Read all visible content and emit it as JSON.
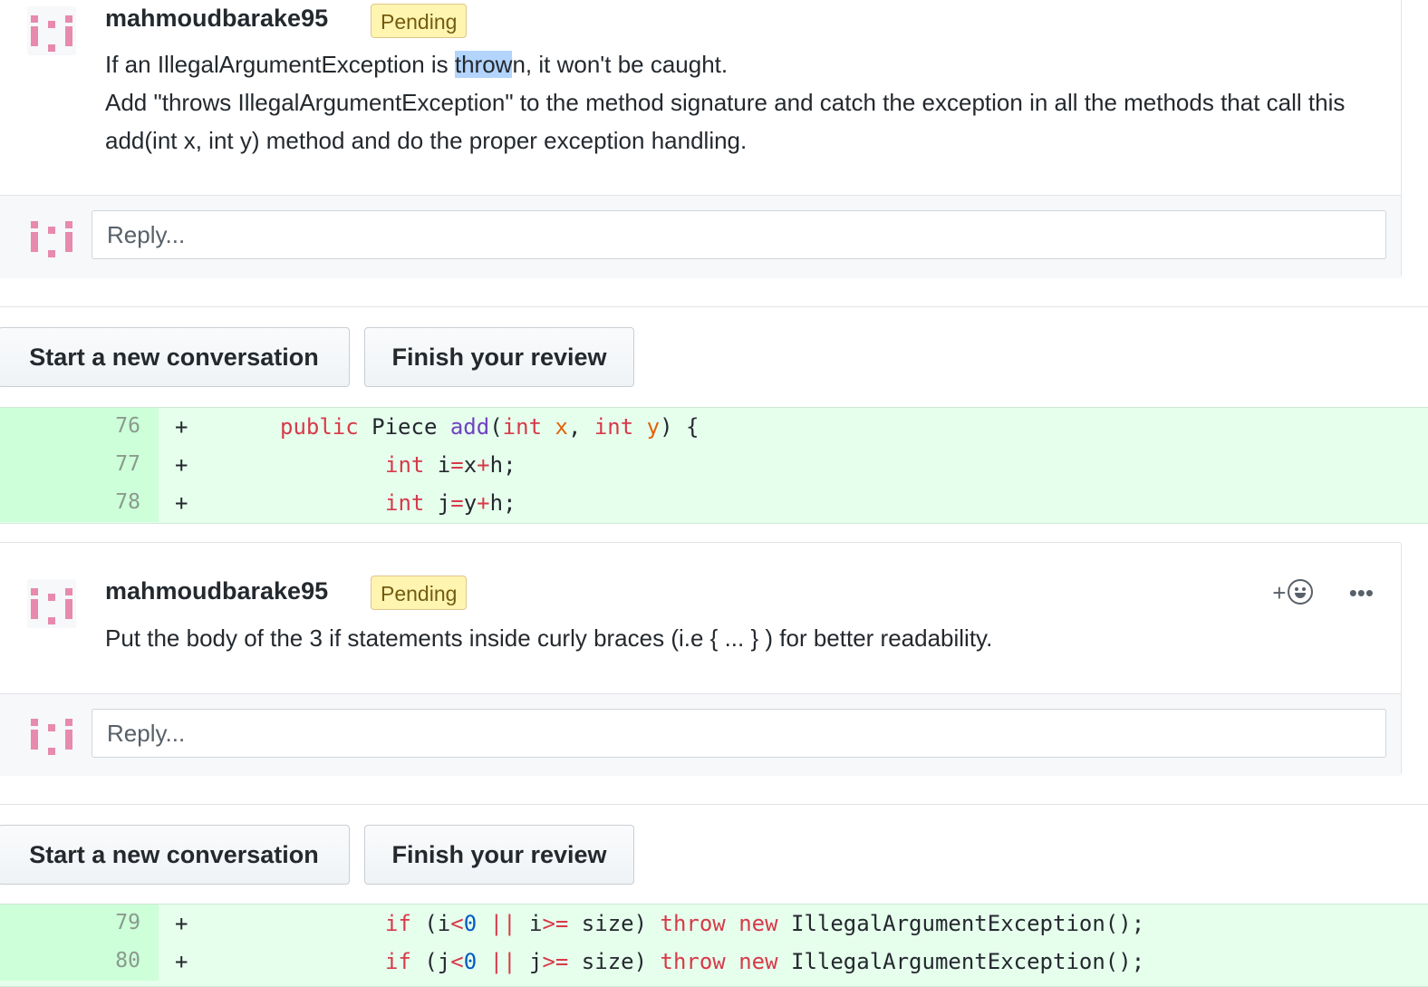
{
  "comments": [
    {
      "author": "mahmoudbarake95",
      "badge": "Pending",
      "line1_pre": "If an IllegalArgumentException is ",
      "line1_sel": "throw",
      "line1_post": "n, it won't be caught.",
      "line2": "Add \"throws IllegalArgumentException\" to the method signature and catch the exception in all the methods that call this add(int x, int y) method and do the proper exception handling.",
      "reply_placeholder": "Reply..."
    },
    {
      "author": "mahmoudbarake95",
      "badge": "Pending",
      "text": "Put the body of the 3 if statements inside curly braces (i.e { ... } ) for better readability.",
      "reply_placeholder": "Reply...",
      "reaction_icon": "smiley-plus-icon",
      "more_icon": "kebab-horizontal-icon"
    }
  ],
  "buttons": {
    "new_conversation": "Start a new conversation",
    "finish_review": "Finish your review"
  },
  "diff_blocks": [
    {
      "lines": [
        {
          "num": "76",
          "mark": "+",
          "code": "public Piece add(int x, int y) {"
        },
        {
          "num": "77",
          "mark": "+",
          "code": "int i=x+h;"
        },
        {
          "num": "78",
          "mark": "+",
          "code": "int j=y+h;"
        }
      ]
    },
    {
      "lines": [
        {
          "num": "79",
          "mark": "+",
          "code": "if (i<0 || i>= size) throw new IllegalArgumentException();"
        },
        {
          "num": "80",
          "mark": "+",
          "code": "if (j<0 || j>= size) throw new IllegalArgumentException();"
        }
      ]
    }
  ],
  "colors": {
    "addition_bg": "#e6ffed",
    "line_number_bg": "#cdffd8",
    "pending_badge_bg": "#fff5b1",
    "keyword": "#d73a49",
    "function": "#6f42c1",
    "variable": "#e36209",
    "number": "#005cc5"
  }
}
